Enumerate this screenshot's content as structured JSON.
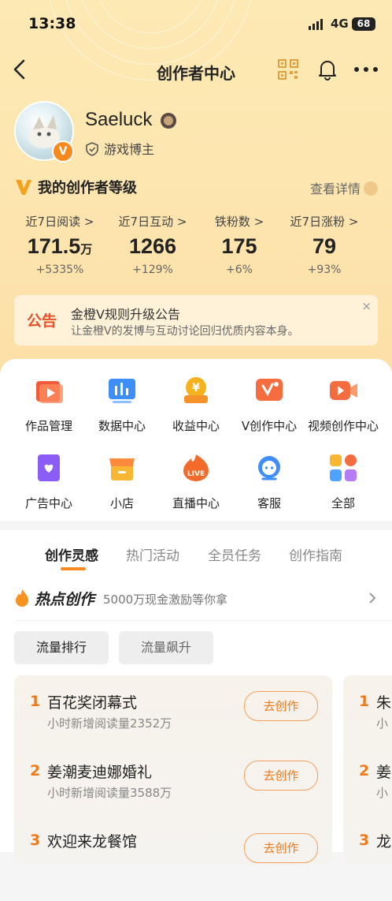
{
  "status": {
    "time": "13:38",
    "network": "4G",
    "battery": "68"
  },
  "nav": {
    "title": "创作者中心",
    "icons": [
      "back-icon",
      "qr-code-icon",
      "bell-icon",
      "more-icon"
    ]
  },
  "profile": {
    "name": "Saeluck",
    "role": "游戏博主",
    "badge": "V"
  },
  "level": {
    "title": "我的创作者等级",
    "detail_label": "查看详情"
  },
  "stats": [
    {
      "label": "近7日阅读 >",
      "value": "171.5",
      "unit": "万",
      "change": "+5335%"
    },
    {
      "label": "近7日互动 >",
      "value": "1266",
      "unit": "",
      "change": "+129%"
    },
    {
      "label": "铁粉数 >",
      "value": "175",
      "unit": "",
      "change": "+6%"
    },
    {
      "label": "近7日涨粉 >",
      "value": "79",
      "unit": "",
      "change": "+93%"
    }
  ],
  "notice": {
    "tag": "公告",
    "title": "金橙V规则升级公告",
    "subtitle": "让金橙V的发博与互动讨论回归优质内容本身。",
    "close": "×"
  },
  "tools": [
    {
      "label": "作品管理",
      "icon": "works-icon"
    },
    {
      "label": "数据中心",
      "icon": "data-icon"
    },
    {
      "label": "收益中心",
      "icon": "income-icon"
    },
    {
      "label": "V创作中心",
      "icon": "v-create-icon"
    },
    {
      "label": "视频创作中心",
      "icon": "video-icon"
    },
    {
      "label": "广告中心",
      "icon": "ad-icon"
    },
    {
      "label": "小店",
      "icon": "shop-icon"
    },
    {
      "label": "直播中心",
      "icon": "live-icon"
    },
    {
      "label": "客服",
      "icon": "service-icon"
    },
    {
      "label": "全部",
      "icon": "all-icon"
    }
  ],
  "live_badge": "LIVE",
  "tabs": [
    "创作灵感",
    "热门活动",
    "全员任务",
    "创作指南"
  ],
  "hot": {
    "title": "热点创作",
    "subtitle": "5000万现金激励等你拿"
  },
  "chips": [
    "流量排行",
    "流量飙升"
  ],
  "card1": [
    {
      "rank": "1",
      "topic": "百花奖闭幕式",
      "metric": "小时新增阅读量2352万",
      "action": "去创作"
    },
    {
      "rank": "2",
      "topic": "姜潮麦迪娜婚礼",
      "metric": "小时新增阅读量3588万",
      "action": "去创作"
    },
    {
      "rank": "3",
      "topic": "欢迎来龙餐馆",
      "metric": "",
      "action": "去创作"
    }
  ],
  "card2": [
    {
      "rank": "1",
      "topic": "朱",
      "metric": "小"
    },
    {
      "rank": "2",
      "topic": "姜",
      "metric": "小"
    },
    {
      "rank": "3",
      "topic": "龙",
      "metric": ""
    }
  ]
}
